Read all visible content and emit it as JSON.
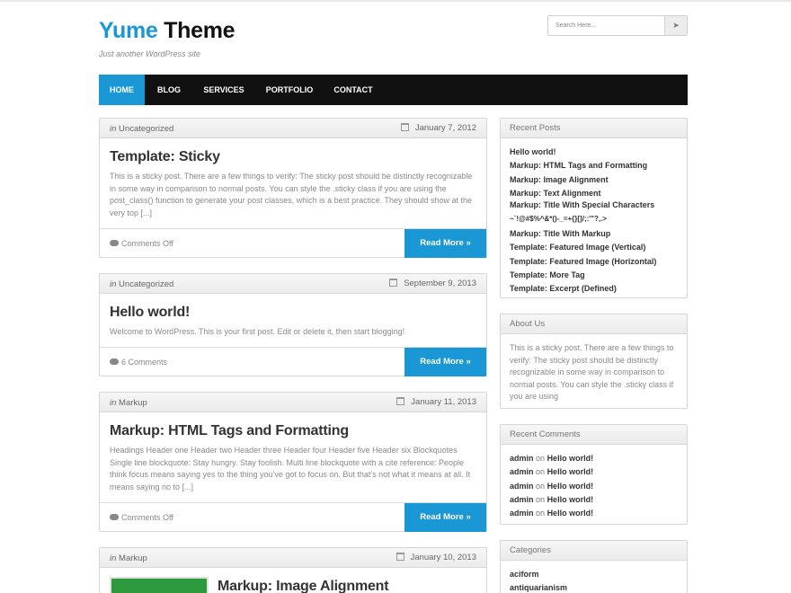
{
  "site": {
    "title_part1": "Yume",
    "title_part2": "Theme",
    "tagline": "Just another WordPress site"
  },
  "search": {
    "placeholder": "Search Here...",
    "button_icon": "arrow-right-icon"
  },
  "nav": {
    "items": [
      {
        "label": "HOME",
        "active": true
      },
      {
        "label": "BLOG"
      },
      {
        "label": "SERVICES"
      },
      {
        "label": "PORTFOLIO"
      },
      {
        "label": "CONTACT"
      }
    ]
  },
  "posts": [
    {
      "in_label": "in",
      "category": "Uncategorized",
      "date": "January 7, 2012",
      "title": "Template: Sticky",
      "excerpt": "This is a sticky post. There are a few things to verify: The sticky post should be distinctly recognizable in some way in comparison to normal posts. You can style the .sticky class if you are using the post_class() function to generate your post classes, which is a best practice. They should show at the very top [...]",
      "comments": "Comments Off",
      "more": "Read More »"
    },
    {
      "in_label": "in",
      "category": "Uncategorized",
      "date": "September 9, 2013",
      "title": "Hello world!",
      "excerpt": "Welcome to WordPress. This is your first post. Edit or delete it, then start blogging!",
      "comments": "6 Comments",
      "more": "Read More »"
    },
    {
      "in_label": "in",
      "category": "Markup",
      "date": "January 11, 2013",
      "title": "Markup: HTML Tags and Formatting",
      "excerpt": "Headings Header one Header two Header three Header four Header five Header six Blockquotes Single line blockquote: Stay hungry. Stay foolish. Multi line blockquote with a cite reference: People think focus means saying yes to the thing you've got to focus on. But that's not what it means at all. It means saying no to [...]",
      "comments": "Comments Off",
      "more": "Read More »"
    },
    {
      "in_label": "in",
      "category": "Markup",
      "date": "January 10, 2013",
      "title": "Markup: Image Alignment"
    }
  ],
  "sidebar": {
    "recent_posts": {
      "title": "Recent Posts",
      "items": [
        "Hello world!",
        "Markup: HTML Tags and Formatting",
        "Markup: Image Alignment",
        "Markup: Text Alignment",
        "Markup: Title With Special Characters",
        "~`!@#$%^&*()-_=+{}[]/;:'\"?,.>",
        "Markup: Title With Markup",
        "Template: Featured Image (Vertical)",
        "Template: Featured Image (Horizontal)",
        "Template: More Tag",
        "Template: Excerpt (Defined)"
      ]
    },
    "about": {
      "title": "About Us",
      "text": "This is a sticky post. There are a few things to verify: The sticky post should be distinctly recognizable in some way in comparison to normal posts. You can style the .sticky class if you are using"
    },
    "recent_comments": {
      "title": "Recent Comments",
      "on_label": "on",
      "items": [
        {
          "author": "admin",
          "post": "Hello world!"
        },
        {
          "author": "admin",
          "post": "Hello world!"
        },
        {
          "author": "admin",
          "post": "Hello world!"
        },
        {
          "author": "admin",
          "post": "Hello world!"
        },
        {
          "author": "admin",
          "post": "Hello world!"
        }
      ]
    },
    "categories": {
      "title": "Categories",
      "items": [
        "aciform",
        "antiquarianism"
      ]
    }
  },
  "colors": {
    "accent": "#1a97d5",
    "nav_bg": "#111111",
    "thumb_green": "#2e9a3e"
  }
}
